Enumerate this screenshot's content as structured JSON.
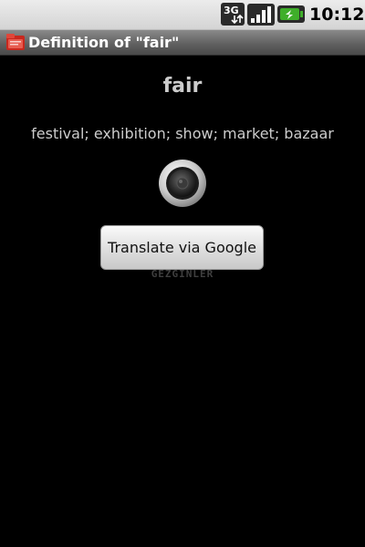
{
  "status_bar": {
    "network_type": "3G",
    "network_icon": "network-3g-icon",
    "signal_icon": "signal-strength-icon",
    "battery_icon": "battery-charging-icon",
    "time": "10:12"
  },
  "title_bar": {
    "app_icon": "dictionary-app-icon",
    "title": "Definition of \"fair\""
  },
  "main": {
    "word": "fair",
    "definition": "festival; exhibition; show; market; bazaar",
    "speaker_icon": "speaker-icon",
    "translate_label": "Translate via Google",
    "watermark": "GEZGINLER"
  },
  "colors": {
    "background": "#000000",
    "status_bar": "#dcdcdc",
    "title_bar": "#5e5e5e",
    "text": "#cccccc",
    "battery_accent": "#3fae2a"
  }
}
